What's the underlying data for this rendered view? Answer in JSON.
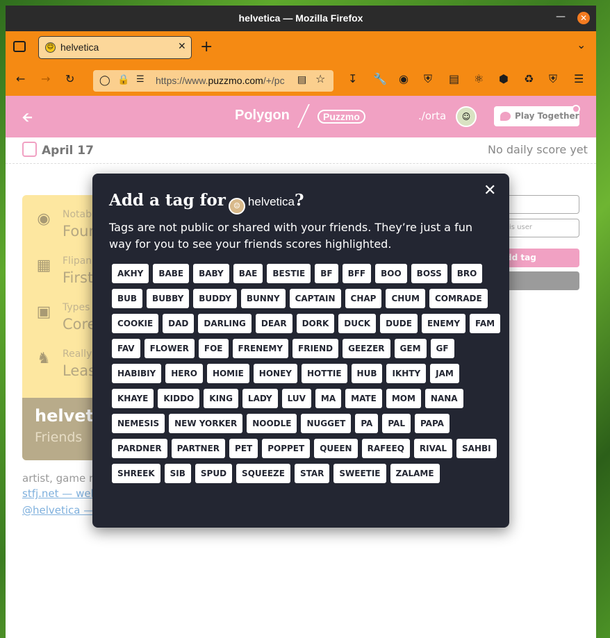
{
  "window": {
    "title": "helvetica — Mozilla Firefox"
  },
  "tab": {
    "label": "helvetica"
  },
  "urlbar": {
    "prefix": "https://www.",
    "domain": "puzzmo.com",
    "suffix": "/+/pc"
  },
  "header": {
    "brand": "Polygon",
    "brand2": "Puzzmo",
    "user": "./orta",
    "play_label": "Play Together"
  },
  "daterow": {
    "date": "April 17",
    "daily_status": "No daily score yet"
  },
  "profile_card": {
    "rows": [
      {
        "small": "Notab",
        "big": "Foun"
      },
      {
        "small": "Flipan",
        "big": "First"
      },
      {
        "small": "Types",
        "big": "Core"
      },
      {
        "small": "Really",
        "big": "Leas"
      }
    ],
    "name": "helveti",
    "subtitle": "Friends"
  },
  "bio": {
    "text": "artist, game m",
    "link1": "stfj.net — web",
    "link2": "@helvetica —"
  },
  "right_form": {
    "note_placeholder": "is user",
    "add_tag_label": "dd tag"
  },
  "modal": {
    "title_prefix": "Add a tag for",
    "title_name": "helvetica",
    "title_suffix": "?",
    "description": "Tags are not public or shared with your friends. They’re just a fun way for you to see your friends scores highlighted.",
    "tags": [
      "AKHY",
      "BABE",
      "BABY",
      "BAE",
      "BESTIE",
      "BF",
      "BFF",
      "BOO",
      "BOSS",
      "BRO",
      "BUB",
      "BUBBY",
      "BUDDY",
      "BUNNY",
      "CAPTAIN",
      "CHAP",
      "CHUM",
      "COMRADE",
      "COOKIE",
      "DAD",
      "DARLING",
      "DEAR",
      "DORK",
      "DUCK",
      "DUDE",
      "ENEMY",
      "FAM",
      "FAV",
      "FLOWER",
      "FOE",
      "FRENEMY",
      "FRIEND",
      "GEEZER",
      "GEM",
      "GF",
      "HABIBIY",
      "HERO",
      "HOMIE",
      "HONEY",
      "HOTTIE",
      "HUB",
      "IKHTY",
      "JAM",
      "KHAYE",
      "KIDDO",
      "KING",
      "LADY",
      "LUV",
      "MA",
      "MATE",
      "MOM",
      "NANA",
      "NEMESIS",
      "NEW YORKER",
      "NOODLE",
      "NUGGET",
      "PA",
      "PAL",
      "PAPA",
      "PARDNER",
      "PARTNER",
      "PET",
      "POPPET",
      "QUEEN",
      "RAFEEQ",
      "RIVAL",
      "SAHBI",
      "SHREEK",
      "SIB",
      "SPUD",
      "SQUEEZE",
      "STAR",
      "SWEETIE",
      "ZALAME"
    ]
  },
  "colors": {
    "toolbar": "#f58a13",
    "header_pink": "#f1a1c3",
    "modal_bg": "#232632",
    "card_yellow": "#fde7a0"
  }
}
